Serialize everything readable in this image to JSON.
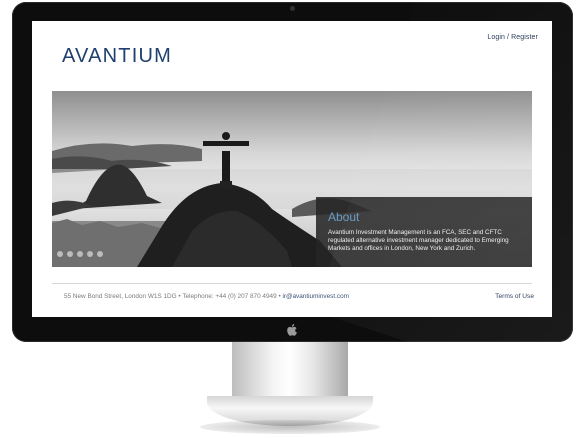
{
  "header": {
    "login_link": "Login / Register",
    "logo": "AVANTIUM"
  },
  "hero": {
    "about_title": "About",
    "about_text": "Avantium Investment Management is an FCA, SEC and CFTC regulated alternative investment manager dedicated to Emerging Markets and offices in London, New York and Zurich."
  },
  "footer": {
    "address": "55 New Bond Street, London W1S 1DG",
    "telephone": "Telephone: +44 (0) 207 870 4949",
    "email": "ir@avantiuminvest.com",
    "terms": "Terms of Use"
  },
  "colors": {
    "brand": "#1f3f6e",
    "about_title": "#6a9cc4",
    "footer_link": "#2a3a57"
  }
}
